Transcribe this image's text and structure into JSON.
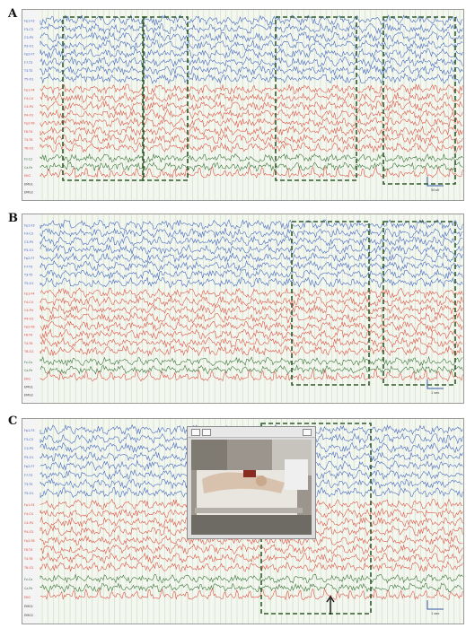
{
  "panels": [
    {
      "letter": "A",
      "labels": [
        "Fp1-F3",
        "F3-C3",
        "C3-P3",
        "P3-O1",
        "Fp2-F7",
        "F7-T3",
        "T3-T5",
        "T5-O1",
        "Fp1-F4",
        "F4-C4",
        "C4-P4",
        "P4-O2",
        "Fp2-F8",
        "F8-T4",
        "T4-T6",
        "T6-O2",
        "Fz-Cz",
        "Cz-Pz",
        "EKG",
        "EMG1",
        "EMG2"
      ],
      "scale": "50uV"
    },
    {
      "letter": "B",
      "labels": [
        "Fp1-F3",
        "F3-C3",
        "C3-P3",
        "P3-O1",
        "Fp2-F7",
        "F7-T3",
        "T3-T5",
        "T5-O1",
        "Fp1-F4",
        "F4-C4",
        "C4-P4",
        "P4-O2",
        "Fp2-F8",
        "F8-T4",
        "T4-T6",
        "T6-O2",
        "Fz-Cz",
        "Cz-Pz",
        "EKG",
        "EMG1",
        "EMG2"
      ],
      "scale": "1 sec"
    },
    {
      "letter": "C",
      "labels": [
        "Fp1-F3",
        "F3-C3",
        "C3-P3",
        "P3-O1",
        "Fp2-F7",
        "F7-T3",
        "T3-T5",
        "T5-O1",
        "Fp1-F4",
        "F4-C4",
        "C4-P4",
        "P4-O2",
        "Fp2-F8",
        "F8-T4",
        "T4-T6",
        "T6-O2",
        "Fz-Cz",
        "Cz-Pz",
        "EKG",
        "EMG1",
        "EMG2"
      ],
      "scale": "1 sec"
    }
  ],
  "colors": {
    "blue": "#3b5fbf",
    "red": "#e0483a",
    "green": "#2f6b2f",
    "box": "#2e5a2a",
    "grid": "#c9dcc0"
  }
}
